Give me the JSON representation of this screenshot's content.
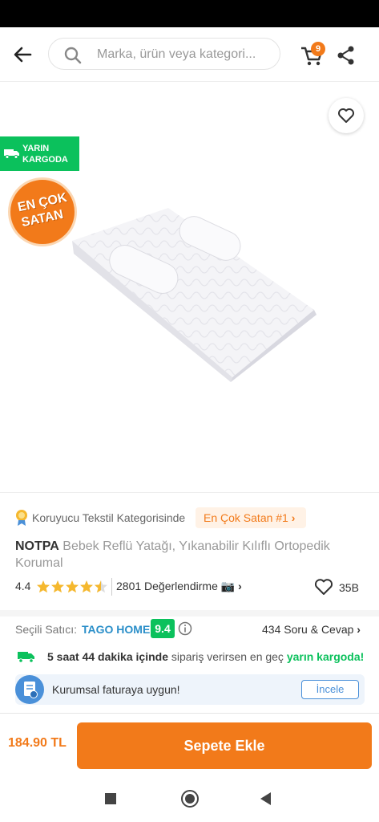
{
  "header": {
    "search_placeholder": "Marka, ürün veya kategori...",
    "cart_count": "9"
  },
  "product_image": {
    "kargo_badge_line1": "YARIN",
    "kargo_badge_line2": "KARGODA",
    "en_cok_line1": "EN ÇOK",
    "en_cok_line2": "SATAN"
  },
  "category": {
    "text": "Koruyucu Tekstil Kategorisinde",
    "badge": "En Çok Satan #1"
  },
  "product": {
    "brand": "NOTPA",
    "name": "Bebek Reflü Yatağı, Yıkanabilir Kılıflı Ortopedik Korumal",
    "rating": "4.4",
    "reviews": "2801 Değerlendirme",
    "likes": "35B"
  },
  "seller": {
    "label": "Seçili Satıcı:",
    "name": "TAGO HOME",
    "score": "9.4",
    "qa": "434 Soru & Cevap"
  },
  "delivery": {
    "time": "5 saat 44 dakika içinde",
    "middle": " sipariş verirsen en geç ",
    "highlight": "yarın kargoda!"
  },
  "invoice": {
    "text": "Kurumsal faturaya uygun!",
    "button": "İncele"
  },
  "bottom": {
    "price": "184.90 TL",
    "add_to_cart": "Sepete Ekle"
  },
  "colors": {
    "brand_orange": "#f27a1a",
    "green": "#0bc15c",
    "seller_blue": "#2b8fc9"
  }
}
